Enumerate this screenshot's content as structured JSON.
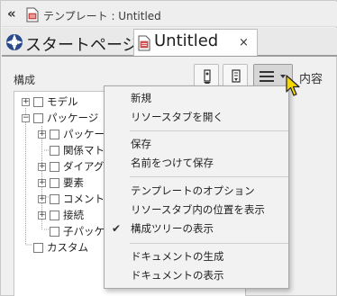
{
  "titlebar": {
    "collapse_glyph": "«",
    "title": "テンプレート : Untitled"
  },
  "tabs": [
    {
      "label": "スタートページ",
      "icon": "start-page-icon",
      "active": false
    },
    {
      "label": "Untitled",
      "icon": "document-icon",
      "active": true,
      "close_glyph": "×"
    }
  ],
  "panel": {
    "label": "構成",
    "content_label": "内容",
    "tools": [
      "edit-document-icon",
      "document-settings-icon",
      "hamburger-menu-icon"
    ]
  },
  "tree": {
    "items": [
      {
        "label": "モデル",
        "expander": "+"
      },
      {
        "label": "パッケージ",
        "expander": "−"
      },
      {
        "label": "パッケージ",
        "expander": "+"
      },
      {
        "label": "関係マトリ",
        "expander": ""
      },
      {
        "label": "ダイアグラ",
        "expander": "+"
      },
      {
        "label": "要素",
        "expander": "+"
      },
      {
        "label": "コメント",
        "expander": "+"
      },
      {
        "label": "接続",
        "expander": "+"
      },
      {
        "label": "子パッケー",
        "expander": ""
      },
      {
        "label": "カスタム",
        "expander": ""
      }
    ]
  },
  "menu": {
    "items": [
      {
        "label": "新規"
      },
      {
        "label": "リソースタブを開く"
      },
      {
        "label": "保存"
      },
      {
        "label": "名前をつけて保存"
      },
      {
        "label": "テンプレートのオプション"
      },
      {
        "label": "リソースタブ内の位置を表示"
      },
      {
        "label": "構成ツリーの表示",
        "checked": true,
        "check_glyph": "✔"
      },
      {
        "label": "ドキュメントの生成"
      },
      {
        "label": "ドキュメントの表示"
      }
    ]
  }
}
